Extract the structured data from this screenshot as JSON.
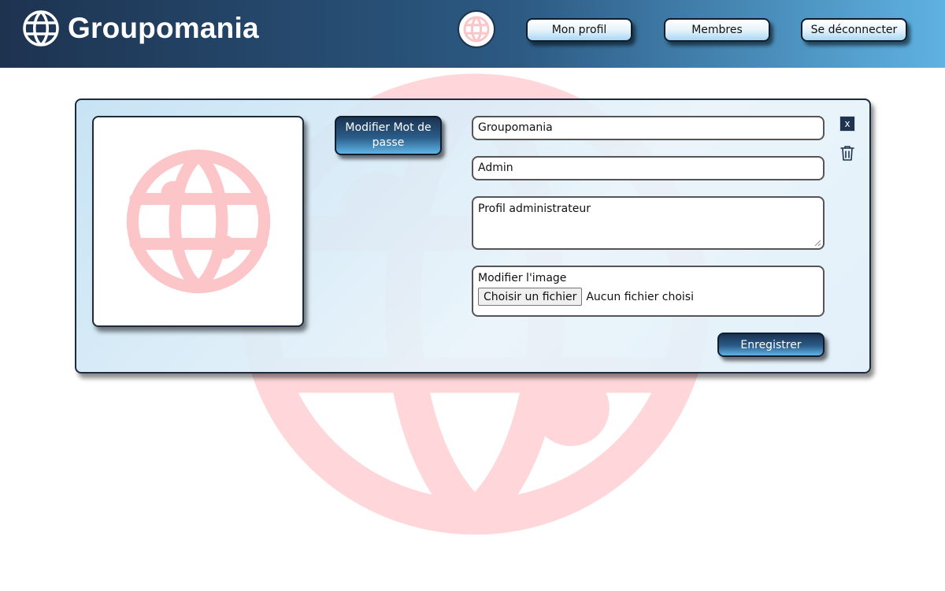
{
  "header": {
    "brand": "Groupomania",
    "nav": {
      "profile_label": "Mon profil",
      "members_label": "Membres",
      "logout_label": "Se déconnecter"
    }
  },
  "profile_form": {
    "change_password_label": "Modifier Mot de passe",
    "name_value": "Groupomania",
    "role_value": "Admin",
    "bio_value": "Profil administrateur",
    "image_field": {
      "label": "Modifier l'image",
      "button_label": "Choisir un fichier",
      "status": "Aucun fichier choisi"
    },
    "save_label": "Enregistrer",
    "close_label": "x"
  },
  "icons": {
    "brand": "globe-icon",
    "avatar": "globe-icon",
    "profile_photo": "globe-icon",
    "delete": "trash-icon"
  },
  "colors": {
    "header_dark": "#1d3350",
    "header_light": "#5fb2e2",
    "logo_pink": "#fcc5c8",
    "watermark_pink": "#ffd6d9"
  }
}
